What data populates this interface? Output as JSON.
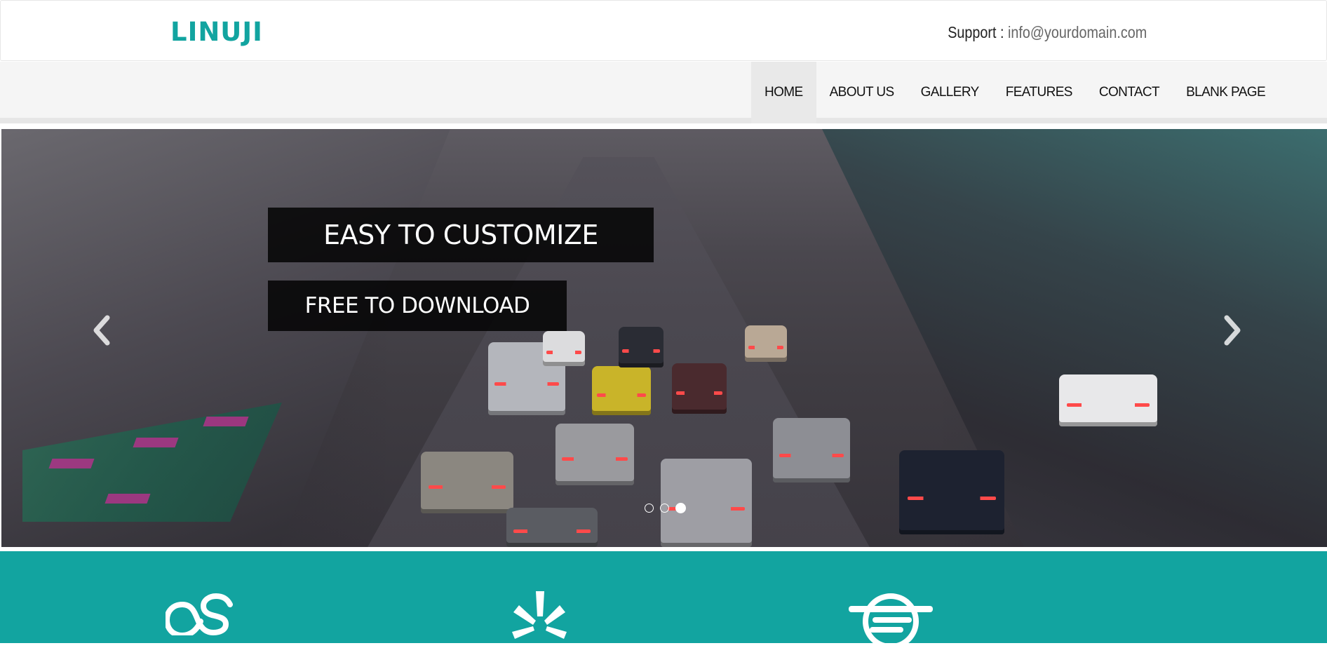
{
  "header": {
    "logo": "LINUJI",
    "support_label": "Support : ",
    "support_email": "info@yourdomain.com"
  },
  "nav": {
    "items": [
      "HOME",
      "ABOUT US",
      "GALLERY",
      "FEATURES",
      "CONTACT",
      "BLANK PAGE"
    ],
    "active": "HOME"
  },
  "slider": {
    "caption_1": "EASY TO CUSTOMIZE",
    "caption_2": "FREE TO DOWNLOAD",
    "prev_icon": "chevron-left-icon",
    "next_icon": "chevron-right-icon",
    "slide_count": 3,
    "active_slide": 3
  },
  "features": {
    "icons": [
      "lastfm-icon",
      "yelp-icon",
      "quora-icon"
    ]
  },
  "colors": {
    "brand": "#12a4a0",
    "nav_bg": "#f5f5f5",
    "caption_bg": "#000000"
  }
}
